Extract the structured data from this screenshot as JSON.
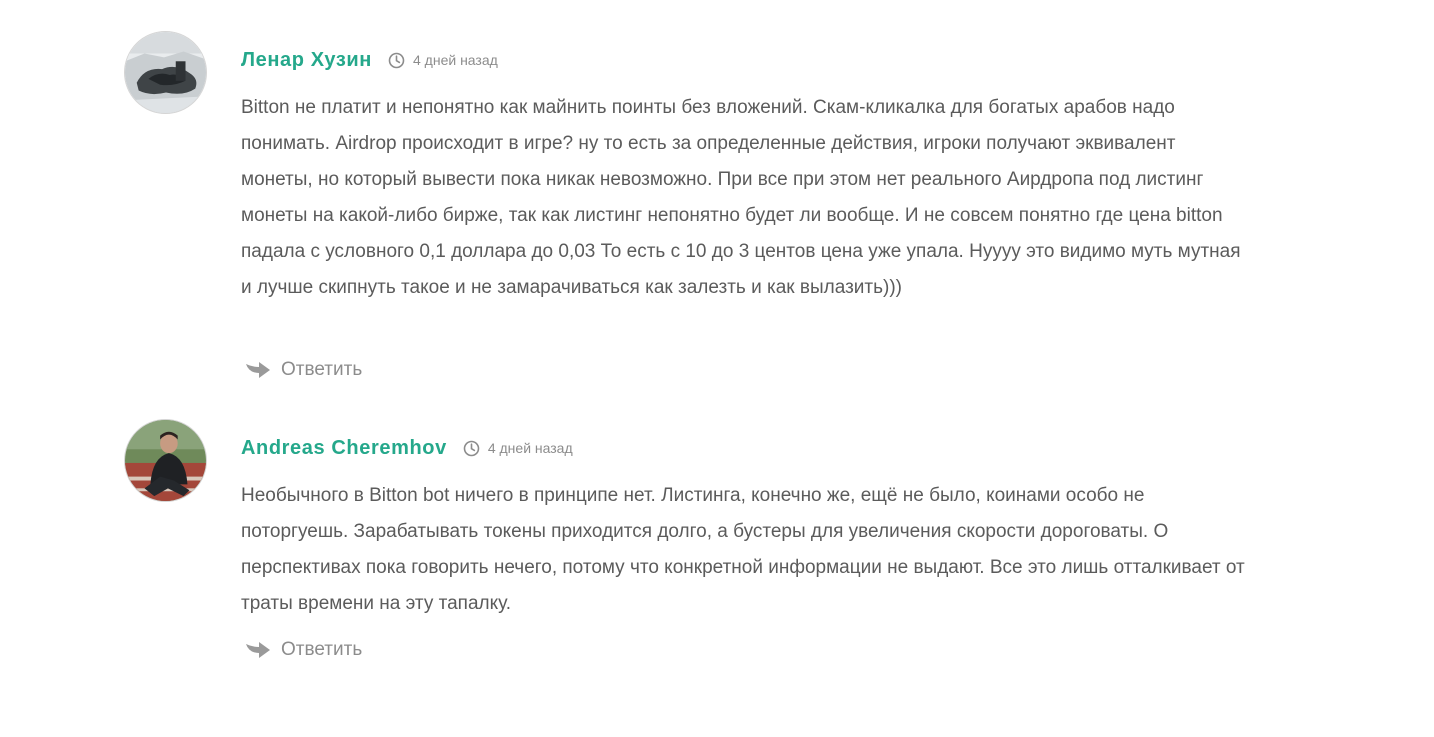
{
  "comments": [
    {
      "author": "Ленар Хузин",
      "time": "4 дней назад",
      "text": "Bitton не платит и непонятно как майнить поинты без вложений. Скам-кликалка для богатых арабов надо понимать. Airdrop происходит в игре? ну то есть за определенные действия, игроки получают эквивалент монеты, но который вывести пока никак невозможно. При все при этом нет реального Аирдропа под листинг монеты на какой-либо бирже, так как листинг непонятно будет ли вообще. И не совсем понятно где цена bitton падала с условного 0,1 доллара до 0,03 То есть с 10 до 3 центов цена уже упала. Нуууу это видимо муть мутная и лучше скипнуть такое и не замарачиваться как залезть и как вылазить)))",
      "reply_label": "Ответить"
    },
    {
      "author": "Andreas Cheremhov",
      "time": "4 дней назад",
      "text": "Необычного в Bitton bot ничего в принципе нет. Листинга, конечно же, ещё не было, коинами особо не поторгуешь. Зарабатывать токены приходится долго, а бустеры для увеличения скорости дороговаты. О перспективах пока говорить нечего, потому что конкретной информации не выдают. Все это лишь отталкивает от траты времени на эту тапалку.",
      "reply_label": "Ответить"
    }
  ],
  "icons": {
    "time": "clock-icon",
    "reply": "reply-arrow-icon"
  },
  "colors": {
    "author": "#25a88b",
    "text": "#5b5b5b",
    "muted": "#8c8c8c"
  }
}
